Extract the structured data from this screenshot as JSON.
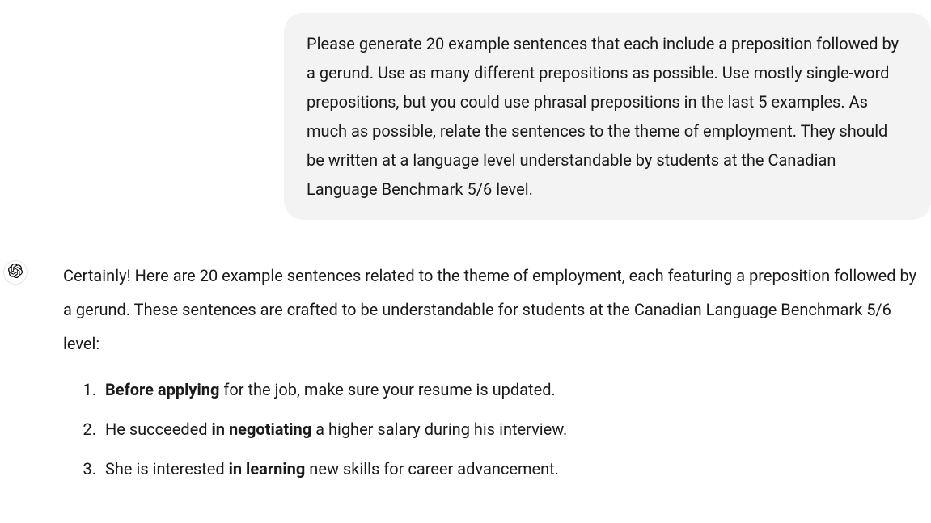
{
  "user_message": {
    "text": "Please generate 20 example sentences that each include a preposition followed by a gerund. Use as many different prepositions as possible. Use mostly single-word prepositions, but you could use phrasal prepositions in the last 5 examples. As much as possible, relate the sentences to the theme of employment. They should be written at a language level understandable by students at the Canadian Language Benchmark 5/6 level."
  },
  "assistant": {
    "intro": "Certainly! Here are 20 example sentences related to the theme of employment, each featuring a preposition followed by a gerund. These sentences are crafted to be understandable for students at the Canadian Language Benchmark 5/6 level:",
    "sentences": [
      {
        "bold": "Before applying",
        "rest": " for the job, make sure your resume is updated."
      },
      {
        "pre": "He succeeded ",
        "bold": "in negotiating",
        "rest": " a higher salary during his interview."
      },
      {
        "pre": "She is interested ",
        "bold": "in learning",
        "rest": " new skills for career advancement."
      }
    ]
  },
  "icon": {
    "name": "openai-logo-icon"
  }
}
